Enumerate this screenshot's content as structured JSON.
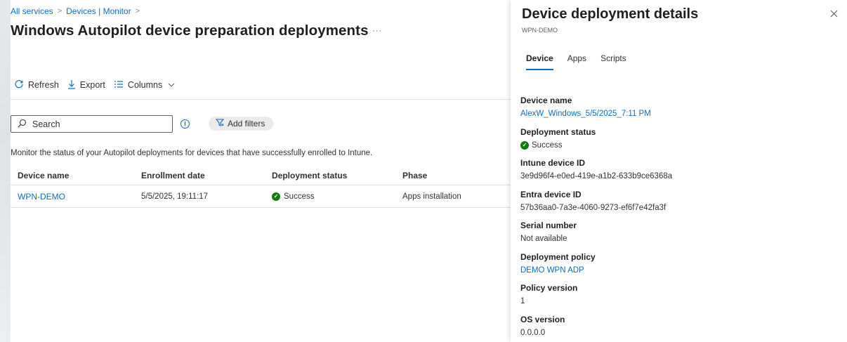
{
  "breadcrumb": {
    "items": [
      "All services",
      "Devices | Monitor"
    ]
  },
  "page": {
    "title": "Windows Autopilot device preparation deployments",
    "more": "···"
  },
  "toolbar": {
    "refresh_label": "Refresh",
    "export_label": "Export",
    "columns_label": "Columns"
  },
  "search": {
    "placeholder": "Search",
    "value": ""
  },
  "filters": {
    "add_label": "Add filters"
  },
  "description": "Monitor the status of your Autopilot deployments for devices that have successfully enrolled to Intune.",
  "table": {
    "columns": [
      "Device name",
      "Enrollment date",
      "Deployment status",
      "Phase"
    ],
    "rows": [
      {
        "device_name": "WPN-DEMO",
        "enrollment_date": "5/5/2025, 19:11:17",
        "deployment_status": "Success",
        "phase": "Apps installation"
      }
    ]
  },
  "panel": {
    "title": "Device deployment details",
    "subtitle": "WPN-DEMO",
    "tabs": [
      "Device",
      "Apps",
      "Scripts"
    ],
    "active_tab": "Device",
    "fields": [
      {
        "label": "Device name",
        "value": "AlexW_Windows_5/5/2025_7:11 PM"
      },
      {
        "label": "Deployment status",
        "value": "Success"
      },
      {
        "label": "Intune device ID",
        "value": "3e9d96f4-e0ed-419e-a1b2-633b9ce6368a"
      },
      {
        "label": "Entra device ID",
        "value": "57b36aa0-7a3e-4060-9273-ef6f7e42fa3f"
      },
      {
        "label": "Serial number",
        "value": "Not available"
      },
      {
        "label": "Deployment policy",
        "value": "DEMO WPN ADP"
      },
      {
        "label": "Policy version",
        "value": "1"
      },
      {
        "label": "OS version",
        "value": "0.0.0.0"
      }
    ]
  },
  "colors": {
    "accent": "#0f6cbd",
    "success": "#107c10"
  },
  "icons": {
    "refresh": "refresh-icon",
    "export": "download-icon",
    "columns": "columns-icon",
    "search": "search-icon",
    "info": "info-icon",
    "filter": "filter-icon",
    "success": "success-check-icon",
    "close": "close-icon"
  }
}
